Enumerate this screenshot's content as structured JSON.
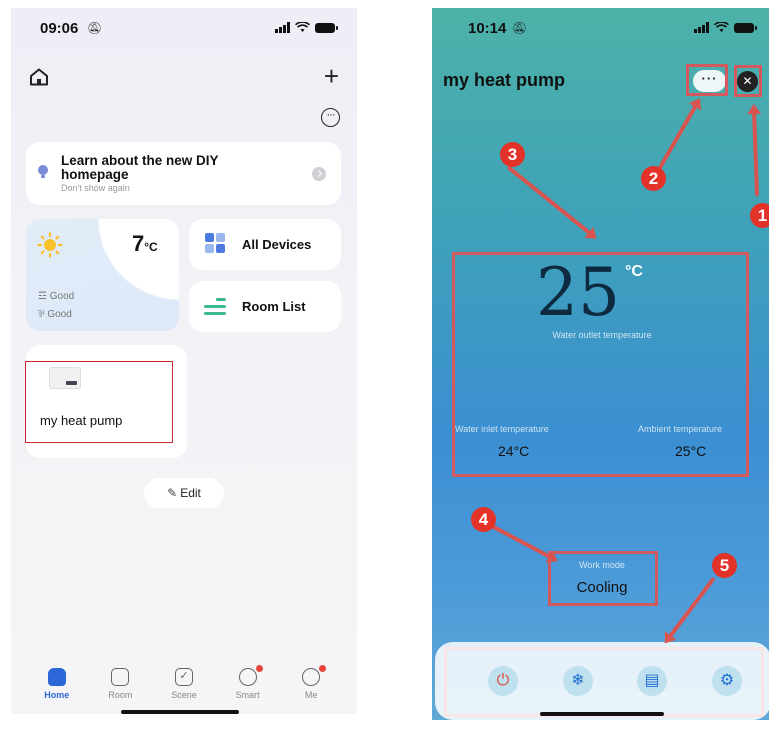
{
  "left": {
    "status_time": "09:06",
    "banner": {
      "title": "Learn about the new DIY homepage",
      "subtitle": "Don't show again"
    },
    "weather": {
      "temperature": "7",
      "unit": "°C",
      "line1": "Good",
      "line2": "Good"
    },
    "tiles": {
      "all_devices": "All Devices",
      "room_list": "Room List"
    },
    "device": {
      "name": "my heat pump"
    },
    "edit_label": "Edit",
    "tabs": [
      {
        "label": "Home"
      },
      {
        "label": "Room"
      },
      {
        "label": "Scene"
      },
      {
        "label": "Smart"
      },
      {
        "label": "Me"
      }
    ],
    "colors": {
      "accent": "#2b67d6",
      "room_list_icon": "#3cb88d"
    }
  },
  "right": {
    "status_time": "10:14",
    "title": "my heat pump",
    "more_label": "···",
    "close_label": "✕",
    "outlet": {
      "value": "25",
      "unit": "°C",
      "label": "Water outlet temperature"
    },
    "inlet": {
      "label": "Water inlet temperature",
      "value": "24°C"
    },
    "ambient": {
      "label": "Ambient temperature",
      "value": "25°C"
    },
    "work_mode": {
      "label": "Work mode",
      "value": "Cooling"
    },
    "controls": [
      "power-icon",
      "snowflake-icon",
      "document-icon",
      "gear-icon"
    ],
    "callouts": [
      "1",
      "2",
      "3",
      "4",
      "5"
    ],
    "colors": {
      "callout": "#e33228",
      "highlight_box": "#d25a5e",
      "power": "#e0443b"
    }
  }
}
